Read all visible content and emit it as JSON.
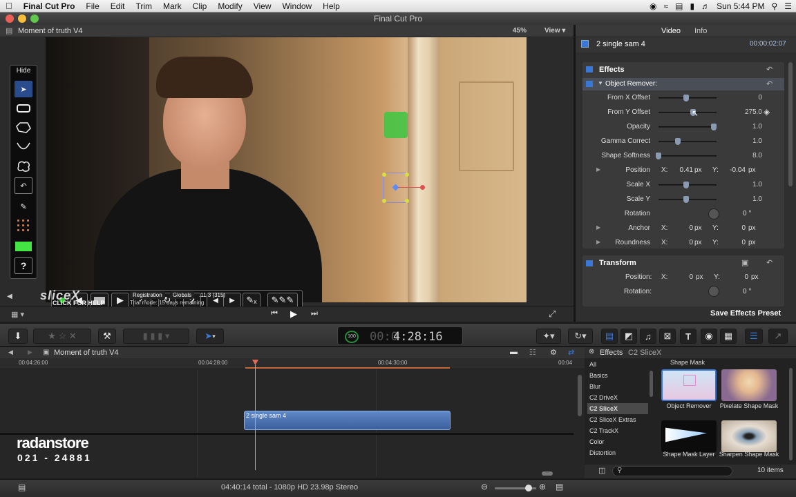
{
  "menubar": {
    "apple": "",
    "app": "Final Cut Pro",
    "items": [
      "File",
      "Edit",
      "Trim",
      "Mark",
      "Clip",
      "Modify",
      "View",
      "Window",
      "Help"
    ],
    "clock": "Sun 5:44 PM"
  },
  "window": {
    "title": "Final Cut Pro"
  },
  "viewer": {
    "project": "Moment of truth V4",
    "zoom": "45%",
    "view_menu": "View",
    "hide_button": "Hide",
    "brand": "sliceX",
    "click_help": "CLICK FOR HELP",
    "registration": "Registration",
    "globals": "Globals",
    "version": ".11.3 (315)",
    "trial": "Trial mode: 15 days remaining",
    "help_symbol": "?"
  },
  "inspector": {
    "tabs": [
      "Video",
      "Info"
    ],
    "clip_name": "2 single sam 4",
    "clip_duration": "00:00:02:07",
    "effects_label": "Effects",
    "effect_name": "Object Remover:",
    "params": [
      {
        "label": "From X Offset",
        "value": "0",
        "level": 0.5
      },
      {
        "label": "From Y Offset",
        "value": "275.0",
        "level": 0.62
      },
      {
        "label": "Opacity",
        "value": "1.0",
        "level": 1.0
      },
      {
        "label": "Gamma Correct",
        "value": "1.0",
        "level": 0.35
      },
      {
        "label": "Shape Softness",
        "value": "8.0",
        "level": 0.0
      }
    ],
    "position": {
      "label": "Position",
      "x_label": "X:",
      "x": "0.41",
      "x_unit": "px",
      "y_label": "Y:",
      "y": "-0.04",
      "y_unit": "px"
    },
    "scale_x": {
      "label": "Scale X",
      "value": "1.0",
      "level": 0.5
    },
    "scale_y": {
      "label": "Scale Y",
      "value": "1.0",
      "level": 0.5
    },
    "rotation": {
      "label": "Rotation",
      "value": "0 °"
    },
    "anchor": {
      "label": "Anchor",
      "x_label": "X:",
      "x": "0",
      "x_unit": "px",
      "y_label": "Y:",
      "y": "0",
      "y_unit": "px"
    },
    "roundness": {
      "label": "Roundness",
      "x_label": "X:",
      "x": "0",
      "x_unit": "px",
      "y_label": "Y:",
      "y": "0",
      "y_unit": "px"
    },
    "transform_label": "Transform",
    "t_position": {
      "label": "Position:",
      "x_label": "X:",
      "x": "0",
      "x_unit": "px",
      "y_label": "Y:",
      "y": "0",
      "y_unit": "px"
    },
    "t_rotation": {
      "label": "Rotation:",
      "value": "0 °"
    },
    "save_preset": "Save Effects Preset"
  },
  "toolbar": {
    "timecode_pct": "100",
    "timecode_dim": "00:0",
    "timecode": "4:28:16"
  },
  "timeline": {
    "project": "Moment of truth V4",
    "ruler": [
      "00:04:26:00",
      "00:04:28:00",
      "00:04:30:00",
      "00:04"
    ],
    "clip": "2 single sam 4",
    "watermark_name": "radanstore",
    "watermark_phone": "021 - 24881"
  },
  "browser": {
    "header": "Effects",
    "subheader": "C2 SliceX",
    "categories": [
      "All",
      "Basics",
      "Blur",
      "C2 DriveX",
      "C2 SliceX",
      "C2 SliceX Extras",
      "C2 TrackX",
      "Color",
      "Distortion"
    ],
    "selected_category": "C2 SliceX",
    "group": "Shape Mask",
    "effects": [
      {
        "name": "Object Remover"
      },
      {
        "name": "Pixelate Shape Mask"
      },
      {
        "name": "Shape Mask Layer"
      },
      {
        "name": "Sharpen Shape Mask"
      }
    ],
    "count": "10 items"
  },
  "status": {
    "text": "04:40:14 total - 1080p HD 23.98p Stereo"
  },
  "colors": {
    "accent": "#3a78d8",
    "green_marker": "#44c444",
    "playhead": "#e06a5a"
  }
}
